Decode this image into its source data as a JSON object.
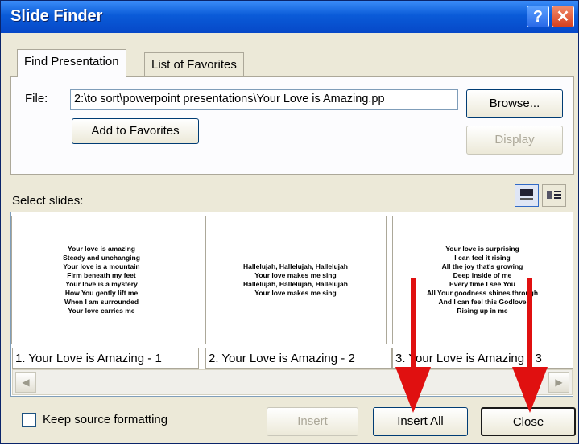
{
  "window": {
    "title": "Slide Finder"
  },
  "tabs": [
    {
      "label": "Find Presentation"
    },
    {
      "label": "List of Favorites"
    }
  ],
  "file": {
    "label": "File:",
    "value": "2:\\to sort\\powerpoint presentations\\Your Love is Amazing.pp"
  },
  "buttons": {
    "browse": "Browse...",
    "add_favorites": "Add to Favorites",
    "display": "Display",
    "insert": "Insert",
    "insert_all": "Insert All",
    "close": "Close"
  },
  "select_slides_label": "Select slides:",
  "slides": [
    {
      "caption": "1. Your Love is Amazing - 1",
      "lines": [
        "Your love is amazing",
        "Steady and unchanging",
        "Your love is a mountain",
        "Firm beneath my feet",
        "Your love is a mystery",
        "How You gently lift me",
        "When I am surrounded",
        "Your love carries me"
      ]
    },
    {
      "caption": "2. Your Love is Amazing - 2",
      "lines": [
        "Hallelujah, Hallelujah, Hallelujah",
        "Your love makes me sing",
        "Hallelujah, Hallelujah, Hallelujah",
        "Your love makes me sing"
      ]
    },
    {
      "caption": "3. Your Love is Amazing - 3",
      "lines": [
        "Your love is surprising",
        "I can feel it rising",
        "All the joy that's growing",
        "Deep inside of me",
        "Every time I see You",
        "All Your goodness shines through",
        "And I can feel this Godlove",
        "Rising up in me"
      ]
    }
  ],
  "keep_source_formatting": {
    "label": "Keep source formatting",
    "checked": false
  },
  "colors": {
    "title_bar": "#0a5bd8",
    "dialog_bg": "#ece9d8",
    "annotation_arrow": "#e01010"
  }
}
